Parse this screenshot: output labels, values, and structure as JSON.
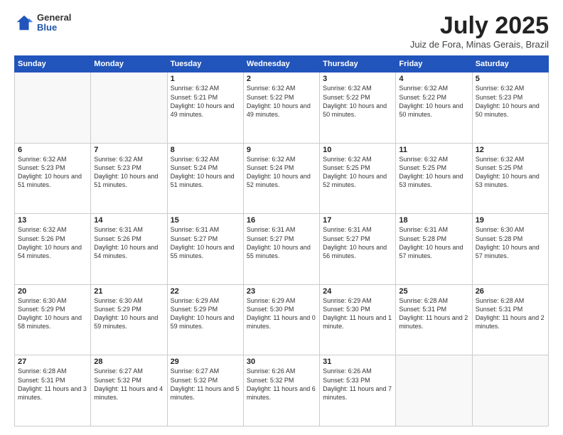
{
  "logo": {
    "general": "General",
    "blue": "Blue"
  },
  "header": {
    "month": "July 2025",
    "location": "Juiz de Fora, Minas Gerais, Brazil"
  },
  "days_of_week": [
    "Sunday",
    "Monday",
    "Tuesday",
    "Wednesday",
    "Thursday",
    "Friday",
    "Saturday"
  ],
  "weeks": [
    [
      {
        "day": "",
        "info": ""
      },
      {
        "day": "",
        "info": ""
      },
      {
        "day": "1",
        "info": "Sunrise: 6:32 AM\nSunset: 5:21 PM\nDaylight: 10 hours and 49 minutes."
      },
      {
        "day": "2",
        "info": "Sunrise: 6:32 AM\nSunset: 5:22 PM\nDaylight: 10 hours and 49 minutes."
      },
      {
        "day": "3",
        "info": "Sunrise: 6:32 AM\nSunset: 5:22 PM\nDaylight: 10 hours and 50 minutes."
      },
      {
        "day": "4",
        "info": "Sunrise: 6:32 AM\nSunset: 5:22 PM\nDaylight: 10 hours and 50 minutes."
      },
      {
        "day": "5",
        "info": "Sunrise: 6:32 AM\nSunset: 5:23 PM\nDaylight: 10 hours and 50 minutes."
      }
    ],
    [
      {
        "day": "6",
        "info": "Sunrise: 6:32 AM\nSunset: 5:23 PM\nDaylight: 10 hours and 51 minutes."
      },
      {
        "day": "7",
        "info": "Sunrise: 6:32 AM\nSunset: 5:23 PM\nDaylight: 10 hours and 51 minutes."
      },
      {
        "day": "8",
        "info": "Sunrise: 6:32 AM\nSunset: 5:24 PM\nDaylight: 10 hours and 51 minutes."
      },
      {
        "day": "9",
        "info": "Sunrise: 6:32 AM\nSunset: 5:24 PM\nDaylight: 10 hours and 52 minutes."
      },
      {
        "day": "10",
        "info": "Sunrise: 6:32 AM\nSunset: 5:25 PM\nDaylight: 10 hours and 52 minutes."
      },
      {
        "day": "11",
        "info": "Sunrise: 6:32 AM\nSunset: 5:25 PM\nDaylight: 10 hours and 53 minutes."
      },
      {
        "day": "12",
        "info": "Sunrise: 6:32 AM\nSunset: 5:25 PM\nDaylight: 10 hours and 53 minutes."
      }
    ],
    [
      {
        "day": "13",
        "info": "Sunrise: 6:32 AM\nSunset: 5:26 PM\nDaylight: 10 hours and 54 minutes."
      },
      {
        "day": "14",
        "info": "Sunrise: 6:31 AM\nSunset: 5:26 PM\nDaylight: 10 hours and 54 minutes."
      },
      {
        "day": "15",
        "info": "Sunrise: 6:31 AM\nSunset: 5:27 PM\nDaylight: 10 hours and 55 minutes."
      },
      {
        "day": "16",
        "info": "Sunrise: 6:31 AM\nSunset: 5:27 PM\nDaylight: 10 hours and 55 minutes."
      },
      {
        "day": "17",
        "info": "Sunrise: 6:31 AM\nSunset: 5:27 PM\nDaylight: 10 hours and 56 minutes."
      },
      {
        "day": "18",
        "info": "Sunrise: 6:31 AM\nSunset: 5:28 PM\nDaylight: 10 hours and 57 minutes."
      },
      {
        "day": "19",
        "info": "Sunrise: 6:30 AM\nSunset: 5:28 PM\nDaylight: 10 hours and 57 minutes."
      }
    ],
    [
      {
        "day": "20",
        "info": "Sunrise: 6:30 AM\nSunset: 5:29 PM\nDaylight: 10 hours and 58 minutes."
      },
      {
        "day": "21",
        "info": "Sunrise: 6:30 AM\nSunset: 5:29 PM\nDaylight: 10 hours and 59 minutes."
      },
      {
        "day": "22",
        "info": "Sunrise: 6:29 AM\nSunset: 5:29 PM\nDaylight: 10 hours and 59 minutes."
      },
      {
        "day": "23",
        "info": "Sunrise: 6:29 AM\nSunset: 5:30 PM\nDaylight: 11 hours and 0 minutes."
      },
      {
        "day": "24",
        "info": "Sunrise: 6:29 AM\nSunset: 5:30 PM\nDaylight: 11 hours and 1 minute."
      },
      {
        "day": "25",
        "info": "Sunrise: 6:28 AM\nSunset: 5:31 PM\nDaylight: 11 hours and 2 minutes."
      },
      {
        "day": "26",
        "info": "Sunrise: 6:28 AM\nSunset: 5:31 PM\nDaylight: 11 hours and 2 minutes."
      }
    ],
    [
      {
        "day": "27",
        "info": "Sunrise: 6:28 AM\nSunset: 5:31 PM\nDaylight: 11 hours and 3 minutes."
      },
      {
        "day": "28",
        "info": "Sunrise: 6:27 AM\nSunset: 5:32 PM\nDaylight: 11 hours and 4 minutes."
      },
      {
        "day": "29",
        "info": "Sunrise: 6:27 AM\nSunset: 5:32 PM\nDaylight: 11 hours and 5 minutes."
      },
      {
        "day": "30",
        "info": "Sunrise: 6:26 AM\nSunset: 5:32 PM\nDaylight: 11 hours and 6 minutes."
      },
      {
        "day": "31",
        "info": "Sunrise: 6:26 AM\nSunset: 5:33 PM\nDaylight: 11 hours and 7 minutes."
      },
      {
        "day": "",
        "info": ""
      },
      {
        "day": "",
        "info": ""
      }
    ]
  ]
}
